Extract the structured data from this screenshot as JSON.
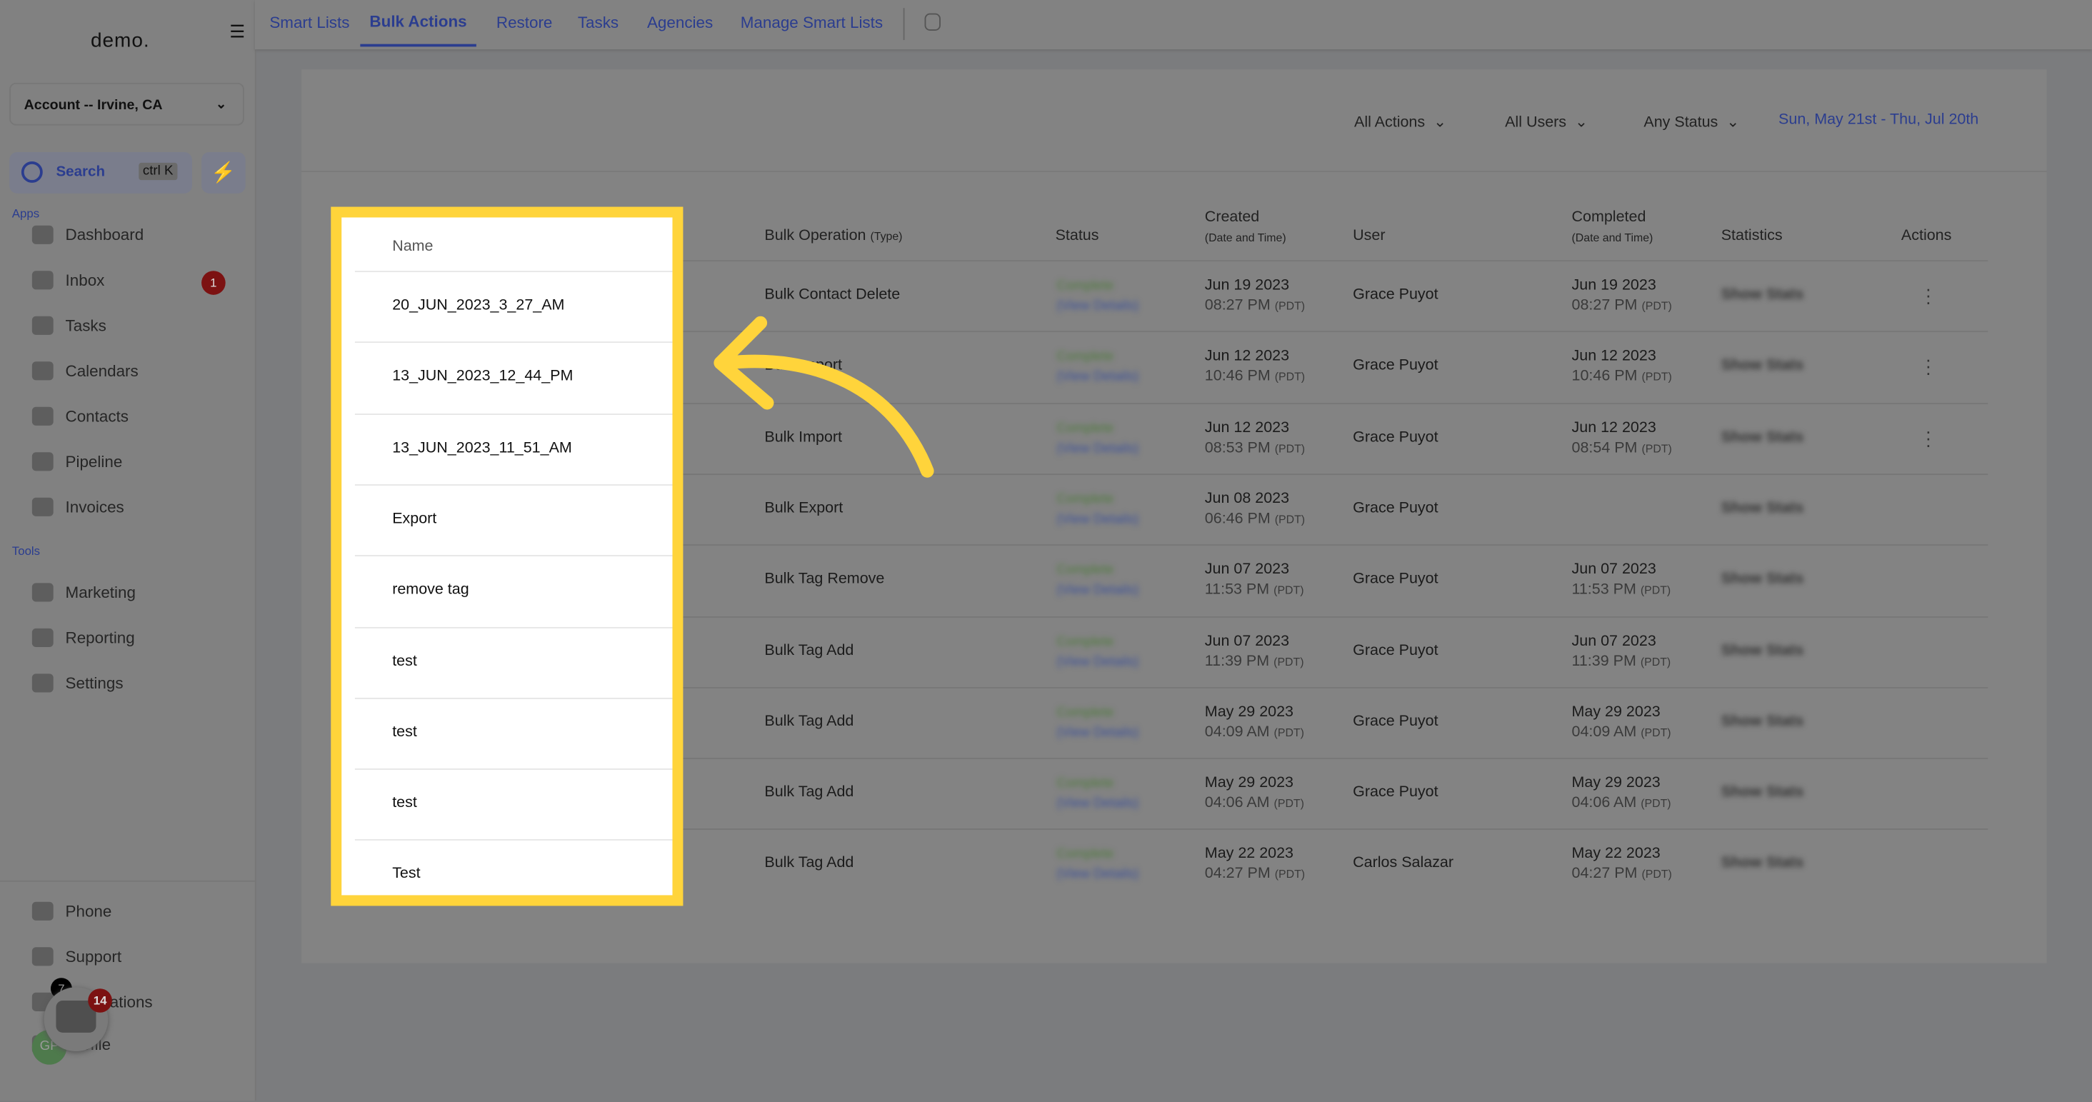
{
  "sidebar": {
    "logo": "demo.",
    "account": "Account -- Irvine, CA",
    "search_label": "Search",
    "search_shortcut": "ctrl K",
    "apps_label": "Apps",
    "tools_label": "Tools",
    "apps": [
      {
        "label": "Dashboard"
      },
      {
        "label": "Inbox",
        "badge": "1"
      },
      {
        "label": "Tasks"
      },
      {
        "label": "Calendars"
      },
      {
        "label": "Contacts"
      },
      {
        "label": "Pipeline"
      },
      {
        "label": "Invoices"
      }
    ],
    "tools": [
      {
        "label": "Marketing"
      },
      {
        "label": "Reporting"
      },
      {
        "label": "Settings"
      }
    ],
    "bottom": [
      {
        "label": "Phone"
      },
      {
        "label": "Support"
      },
      {
        "label": "Notifications"
      },
      {
        "label": "Profile"
      }
    ],
    "notif_badge": "7",
    "chat_badge": "14",
    "avatar_initials": "GP"
  },
  "tabs": [
    {
      "label": "Smart Lists"
    },
    {
      "label": "Bulk Actions",
      "active": true
    },
    {
      "label": "Restore"
    },
    {
      "label": "Tasks"
    },
    {
      "label": "Agencies"
    },
    {
      "label": "Manage Smart Lists"
    }
  ],
  "filters": {
    "actions": "All Actions",
    "users": "All Users",
    "status": "Any Status",
    "date_range": "Sun, May 21st - Thu, Jul 20th"
  },
  "columns": {
    "name": "Name",
    "op": "Bulk Operation",
    "op_sub": "(Type)",
    "status": "Status",
    "created": "Created",
    "dt_sub": "(Date and Time)",
    "user": "User",
    "completed": "Completed",
    "statistics": "Statistics",
    "actions": "Actions"
  },
  "status_text": "Complete",
  "details_text": "(View Details)",
  "stats_text": "Show Stats",
  "tz": "(PDT)",
  "rows": [
    {
      "name": "20_JUN_2023_3_27_AM",
      "op": "Bulk Contact Delete",
      "c_date": "Jun 19 2023",
      "c_time": "08:27 PM",
      "user": "Grace Puyot",
      "d_date": "Jun 19 2023",
      "d_time": "08:27 PM",
      "menu": true
    },
    {
      "name": "13_JUN_2023_12_44_PM",
      "op": "Bulk Import",
      "c_date": "Jun 12 2023",
      "c_time": "10:46 PM",
      "user": "Grace Puyot",
      "d_date": "Jun 12 2023",
      "d_time": "10:46 PM",
      "menu": true
    },
    {
      "name": "13_JUN_2023_11_51_AM",
      "op": "Bulk Import",
      "c_date": "Jun 12 2023",
      "c_time": "08:53 PM",
      "user": "Grace Puyot",
      "d_date": "Jun 12 2023",
      "d_time": "08:54 PM",
      "menu": true
    },
    {
      "name": "Export",
      "op": "Bulk Export",
      "c_date": "Jun 08 2023",
      "c_time": "06:46 PM",
      "user": "Grace Puyot",
      "d_date": "",
      "d_time": ""
    },
    {
      "name": "remove tag",
      "op": "Bulk Tag Remove",
      "c_date": "Jun 07 2023",
      "c_time": "11:53 PM",
      "user": "Grace Puyot",
      "d_date": "Jun 07 2023",
      "d_time": "11:53 PM"
    },
    {
      "name": "test",
      "op": "Bulk Tag Add",
      "c_date": "Jun 07 2023",
      "c_time": "11:39 PM",
      "user": "Grace Puyot",
      "d_date": "Jun 07 2023",
      "d_time": "11:39 PM"
    },
    {
      "name": "test",
      "op": "Bulk Tag Add",
      "c_date": "May 29 2023",
      "c_time": "04:09 AM",
      "user": "Grace Puyot",
      "d_date": "May 29 2023",
      "d_time": "04:09 AM"
    },
    {
      "name": "test",
      "op": "Bulk Tag Add",
      "c_date": "May 29 2023",
      "c_time": "04:06 AM",
      "user": "Grace Puyot",
      "d_date": "May 29 2023",
      "d_time": "04:06 AM"
    },
    {
      "name": "Test",
      "op": "Bulk Tag Add",
      "c_date": "May 22 2023",
      "c_time": "04:27 PM",
      "user": "Carlos Salazar",
      "d_date": "May 22 2023",
      "d_time": "04:27 PM"
    }
  ],
  "colors": {
    "highlight": "#FFD43B",
    "accent": "#2b3d8f",
    "badge": "#7c1212"
  }
}
